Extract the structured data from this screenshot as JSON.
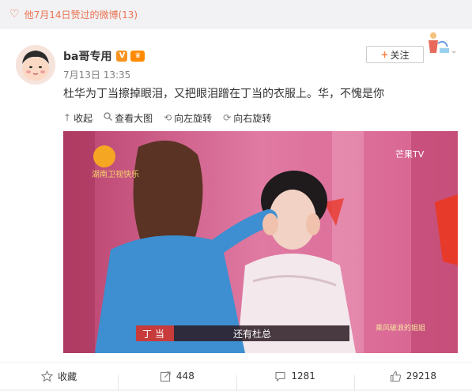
{
  "header": {
    "liked_text": "他7月14日赞过的微博(13)"
  },
  "post": {
    "username": "ba哥专用",
    "vip_badge": "V",
    "timestamp": "7月13日 13:35",
    "follow_label": "关注",
    "text": "杜华为丁当擦掉眼泪，又把眼泪蹭在丁当的衣服上。华，不愧是你"
  },
  "media_toolbar": {
    "collapse": "收起",
    "view_large": "查看大图",
    "rotate_left": "向左旋转",
    "rotate_right": "向右旋转"
  },
  "photo": {
    "channel_logo": "湖南卫视快乐",
    "platform_logo": "芒果TV",
    "subtitle_name": "丁 当",
    "subtitle_text": "还有杜总",
    "show_logo": "乘风破浪的姐姐"
  },
  "actions": {
    "favorite": "收藏",
    "repost": "448",
    "comment": "1281",
    "like": "29218"
  },
  "colors": {
    "accent": "#eb7350",
    "follow_plus": "#ff8140",
    "photo_pink": "#d65c8c",
    "jacket_blue": "#3d8fd1"
  }
}
